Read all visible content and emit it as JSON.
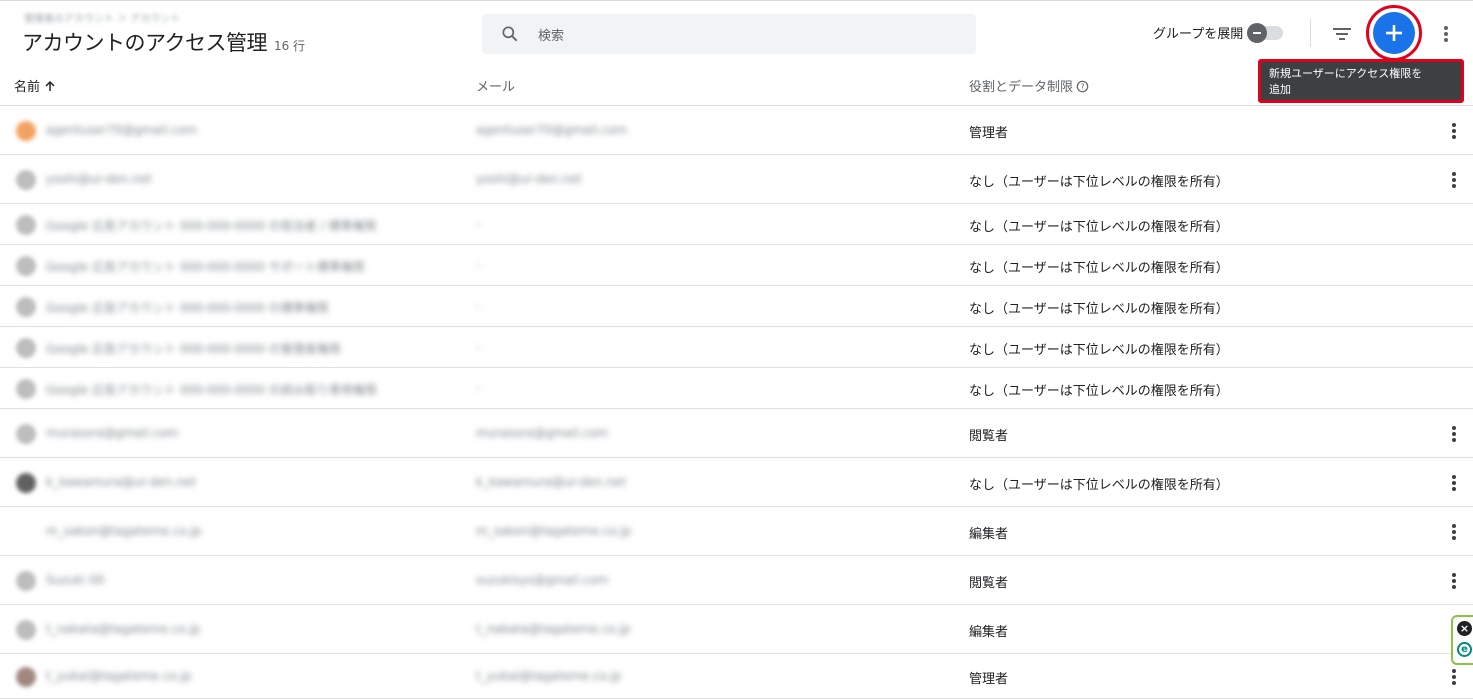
{
  "breadcrumb": "管理者のアカウント ＞ アカウント",
  "page": {
    "title": "アカウントのアクセス管理",
    "row_count": "16 行"
  },
  "search": {
    "placeholder": "検索"
  },
  "toolbar": {
    "group_expand_label": "グループを展開"
  },
  "tooltip": {
    "line1": "新規ユーザーにアクセス権限を",
    "line2": "追加"
  },
  "table": {
    "columns": {
      "name": "名前",
      "email": "メール",
      "role": "役割とデータ制限"
    },
    "rows": [
      {
        "name": "agentuser70@gmail.com",
        "email": "agentuser70@gmail.com",
        "role": "管理者",
        "has_menu": true,
        "avatar_color": "#f4a261"
      },
      {
        "name": "yoshi@ur-den.net",
        "email": "yoshi@ur-den.net",
        "role": "なし（ユーザーは下位レベルの権限を所有）",
        "has_menu": true,
        "avatar_color": "#bdbdbd"
      },
      {
        "name": "Google 広告アカウント 000-000-0000 の担当者 / 標準権限",
        "email": "-",
        "role": "なし（ユーザーは下位レベルの権限を所有）",
        "has_menu": false,
        "avatar_color": "#bdbdbd"
      },
      {
        "name": "Google 広告アカウント 000-000-0000 サポート標準権限",
        "email": "-",
        "role": "なし（ユーザーは下位レベルの権限を所有）",
        "has_menu": false,
        "avatar_color": "#bdbdbd"
      },
      {
        "name": "Google 広告アカウント 000-000-0000 の標準権限",
        "email": "-",
        "role": "なし（ユーザーは下位レベルの権限を所有）",
        "has_menu": false,
        "avatar_color": "#bdbdbd"
      },
      {
        "name": "Google 広告アカウント 000-000-0000 の管理者権限",
        "email": "-",
        "role": "なし（ユーザーは下位レベルの権限を所有）",
        "has_menu": false,
        "avatar_color": "#bdbdbd"
      },
      {
        "name": "Google 広告アカウント 000-000-0000 の読み取り専用権限",
        "email": "-",
        "role": "なし（ユーザーは下位レベルの権限を所有）",
        "has_menu": false,
        "avatar_color": "#bdbdbd"
      },
      {
        "name": "murasora@gmail.com",
        "email": "murasora@gmail.com",
        "role": "閲覧者",
        "has_menu": true,
        "avatar_color": "#bdbdbd"
      },
      {
        "name": "k_kawamura@ur-den.net",
        "email": "k_kawamura@ur-den.net",
        "role": "なし（ユーザーは下位レベルの権限を所有）",
        "has_menu": true,
        "avatar_color": "#616161"
      },
      {
        "name": "m_sakon@tagateme.co.jp",
        "email": "m_sakon@tagateme.co.jp",
        "role": "編集者",
        "has_menu": true,
        "avatar_color": "#ffffff"
      },
      {
        "name": "Suzuki 00",
        "email": "suzukisys@gmail.com",
        "role": "閲覧者",
        "has_menu": true,
        "avatar_color": "#bdbdbd"
      },
      {
        "name": "t_nakata@tagateme.co.jp",
        "email": "t_nakata@tagateme.co.jp",
        "role": "編集者",
        "has_menu": true,
        "avatar_color": "#bdbdbd"
      },
      {
        "name": "t_yukai@tagateme.co.jp",
        "email": "t_yukai@tagateme.co.jp",
        "role": "管理者",
        "has_menu": true,
        "avatar_color": "#a1887f"
      }
    ]
  }
}
